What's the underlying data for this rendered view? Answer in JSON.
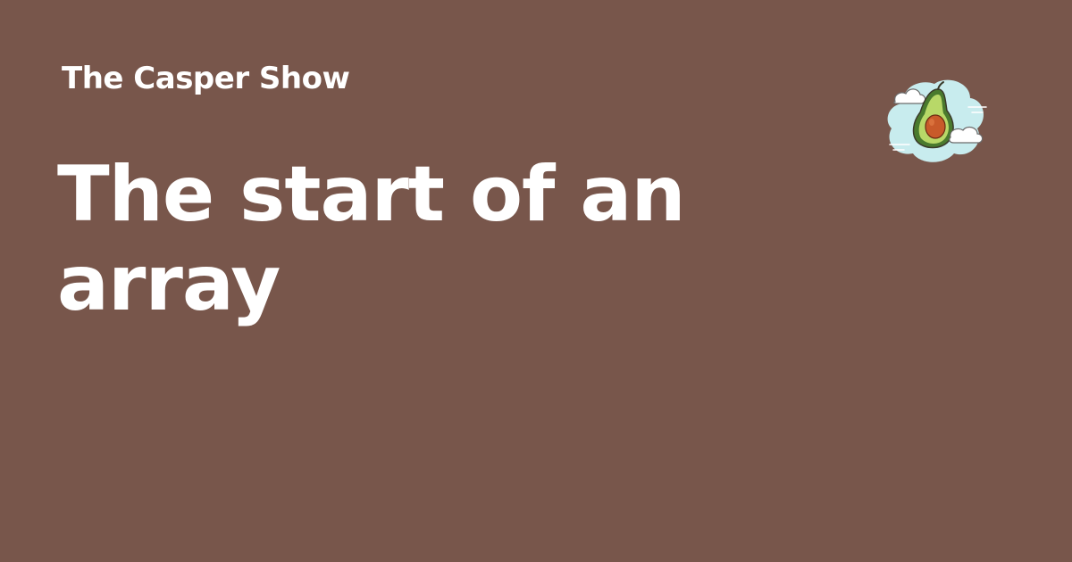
{
  "site": {
    "name": "The Casper Show"
  },
  "post": {
    "title": "The start of an array"
  },
  "logo": {
    "icon": "avocado-icon"
  },
  "colors": {
    "background": "#78564b",
    "text": "#ffffff",
    "logo_cloud_bg": "#c8ecee",
    "avocado_skin": "#4a7a2e",
    "avocado_flesh": "#b8d868",
    "avocado_pit": "#c85a2a"
  }
}
